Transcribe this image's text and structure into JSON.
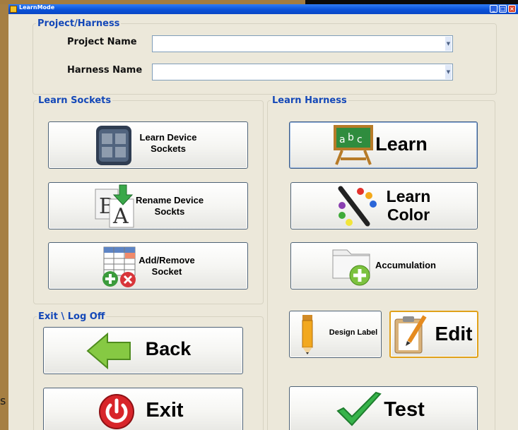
{
  "window": {
    "title": "LearnMode"
  },
  "desktop_text": "s",
  "project_group": {
    "legend": "Project/Harness",
    "project_name_label": "Project Name",
    "project_name_value": "",
    "harness_name_label": "Harness Name",
    "harness_name_value": ""
  },
  "learn_sockets": {
    "legend": "Learn Sockets",
    "learn_device_sockets": "Learn Device Sockets",
    "rename_device_sockets": "Rename Device Sockts",
    "add_remove_socket": "Add/Remove Socket"
  },
  "learn_harness": {
    "legend": "Learn Harness",
    "learn": "Learn",
    "learn_color": "Learn Color",
    "accumulation": "Accumulation",
    "design_label": "Design Label",
    "edit": "Edit",
    "test": "Test"
  },
  "exit_group": {
    "legend": "Exit \\ Log Off",
    "back": "Back",
    "exit": "Exit"
  },
  "icons": {
    "app": "learnmode-app-icon",
    "grid": "device-grid-icon",
    "rename": "rename-ba-icon",
    "add_remove": "table-add-remove-icon",
    "chalkboard": "abc-chalkboard-icon",
    "palette": "color-pencil-icon",
    "folder_add": "folder-add-icon",
    "pencil": "pencil-icon",
    "clipboard": "clipboard-edit-icon",
    "back_arrow": "green-back-arrow-icon",
    "power": "red-power-icon",
    "check": "green-check-icon"
  },
  "colors": {
    "titlebar": "#0a52d9",
    "legend_text": "#1448b8",
    "form_bg": "#ece8da",
    "desktop": "#a67f43",
    "edit_border": "#e0a11a"
  }
}
